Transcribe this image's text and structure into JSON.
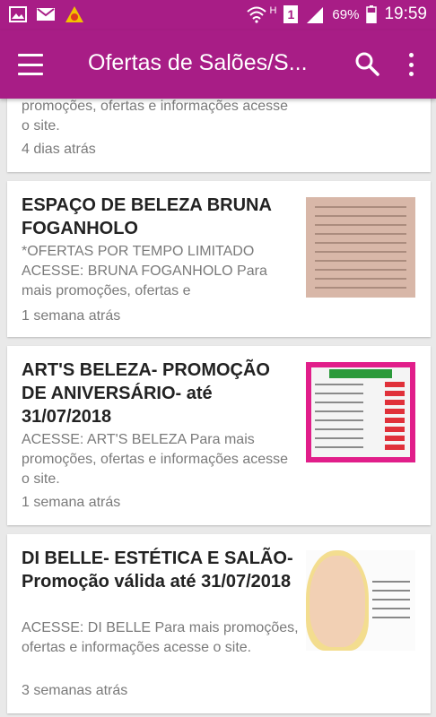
{
  "status_bar": {
    "battery_percent": "69%",
    "time": "19:59",
    "sim_slot": "1",
    "network_type": "H",
    "icons": [
      "gallery-icon",
      "gmail-icon",
      "app-alert-icon",
      "wifi-icon",
      "signal-icon",
      "battery-icon"
    ]
  },
  "app_bar": {
    "title": "Ofertas de Salões/S...",
    "color": "#a81d86",
    "icons": [
      "menu-icon",
      "search-icon",
      "more-vert-icon"
    ]
  },
  "feed": {
    "items": [
      {
        "summary": "promoções, ofertas e informações acesse o site.",
        "time": "4 dias atrás"
      },
      {
        "title": "ESPAÇO DE BELEZA  BRUNA FOGANHOLO",
        "summary": "*OFERTAS POR TEMPO LIMITADO ACESSE: BRUNA FOGANHOLO Para mais promoções, ofertas e",
        "time": "1 semana atrás"
      },
      {
        "title": "ART'S BELEZA- PROMOÇÃO DE ANIVERSÁRIO- até 31/07/2018",
        "summary": "ACESSE: ART'S BELEZA Para mais promoções, ofertas e informações acesse o site.",
        "time": "1 semana atrás"
      },
      {
        "title": "DI BELLE- ESTÉTICA E SALÃO- Promoção válida até 31/07/2018",
        "summary": "ACESSE: DI BELLE Para mais promoções, ofertas e informações acesse o site.",
        "time": "3 semanas atrás"
      }
    ]
  }
}
